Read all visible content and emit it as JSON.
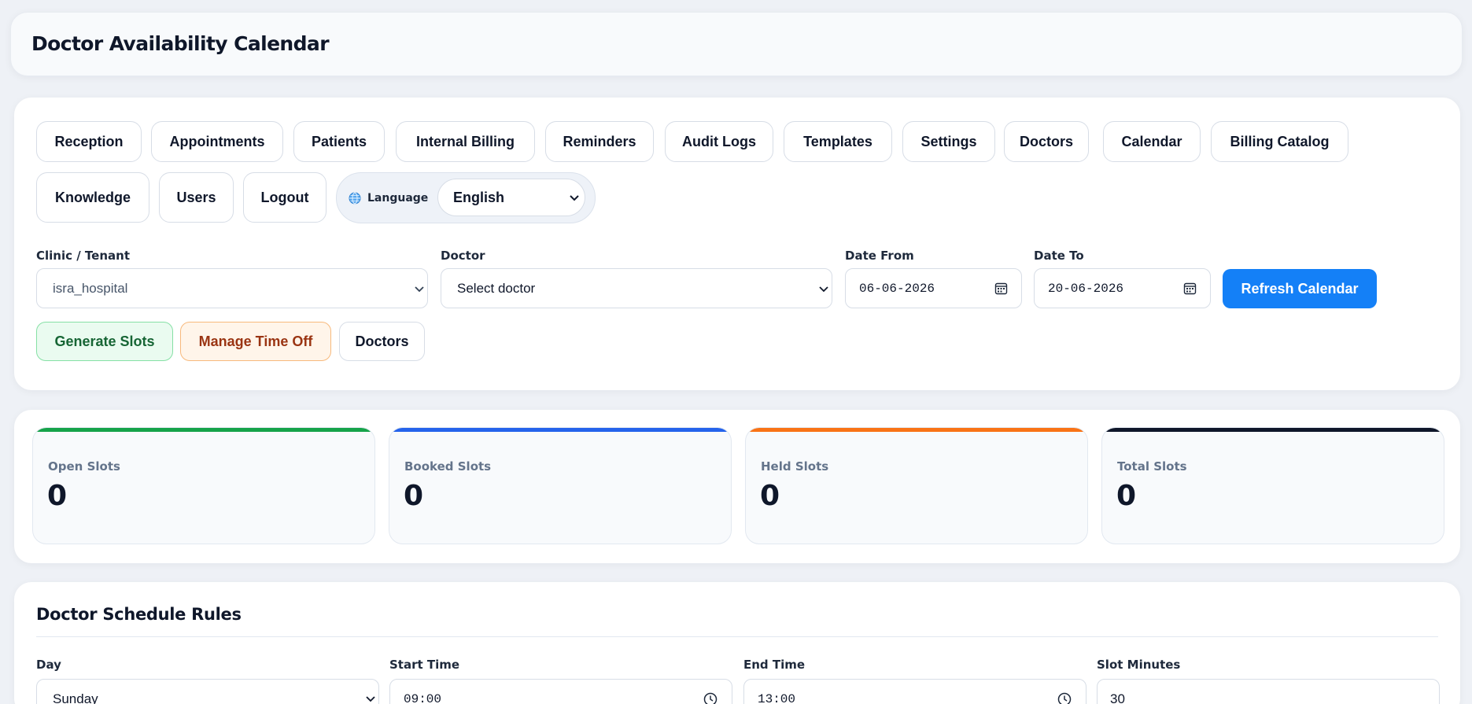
{
  "page_title": "Doctor Availability Calendar",
  "nav": {
    "items": [
      "Reception",
      "Appointments",
      "Patients",
      "Internal Billing",
      "Reminders",
      "Audit Logs",
      "Templates",
      "Settings",
      "Doctors",
      "Calendar",
      "Billing Catalog",
      "Knowledge",
      "Users",
      "Logout"
    ],
    "language_icon": "globe-icon",
    "language_label": "Language",
    "language_value": "English"
  },
  "filters": {
    "clinic_label": "Clinic / Tenant",
    "clinic_value": "isra_hospital",
    "doctor_label": "Doctor",
    "doctor_value": "Select doctor",
    "date_from_label": "Date From",
    "date_from_value": "06-06-2026",
    "date_to_label": "Date To",
    "date_to_value": "20-06-2026",
    "refresh_label": "Refresh Calendar"
  },
  "actions": {
    "generate_label": "Generate Slots",
    "time_off_label": "Manage Time Off",
    "doctors_label": "Doctors"
  },
  "stats": [
    {
      "label": "Open Slots",
      "value": "0",
      "color": "#16a34a"
    },
    {
      "label": "Booked Slots",
      "value": "0",
      "color": "#2563eb"
    },
    {
      "label": "Held Slots",
      "value": "0",
      "color": "#f97316"
    },
    {
      "label": "Total Slots",
      "value": "0",
      "color": "#0f172a"
    }
  ],
  "rules": {
    "title": "Doctor Schedule Rules",
    "day_label": "Day",
    "day_value": "Sunday",
    "start_label": "Start Time",
    "start_value": "09:00",
    "end_label": "End Time",
    "end_value": "13:00",
    "slot_label": "Slot Minutes",
    "slot_value": "30"
  },
  "colors": {
    "primary": "#1480f7",
    "background": "#eef1f6"
  }
}
